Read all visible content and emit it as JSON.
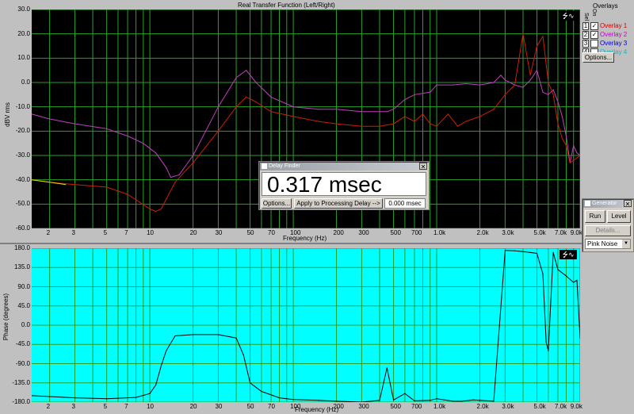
{
  "top_chart": {
    "title": "Real Transfer Function (Left/Right)",
    "ylabel": "dBV rms",
    "xlabel": "Frequency (Hz)",
    "yticks": [
      "30.0",
      "20.0",
      "10.0",
      "0.0",
      "-10.0",
      "-20.0",
      "-30.0",
      "-40.0",
      "-50.0",
      "-60.0"
    ],
    "xticks": [
      "2",
      "3",
      "5",
      "7",
      "10",
      "20",
      "30",
      "50",
      "70",
      "100",
      "200",
      "300",
      "500",
      "700",
      "1.0k",
      "2.0k",
      "3.0k",
      "5.0k",
      "7.0k",
      "9.0k"
    ]
  },
  "bottom_chart": {
    "ylabel": "Phase (degrees)",
    "xlabel": "Frequency (Hz)",
    "yticks": [
      "180.0",
      "135.0",
      "90.0",
      "45.0",
      "0.0",
      "-45.0",
      "-90.0",
      "-135.0",
      "-180.0"
    ],
    "xticks": [
      "2",
      "3",
      "5",
      "7",
      "10",
      "20",
      "30",
      "50",
      "70",
      "100",
      "200",
      "300",
      "500",
      "700",
      "1.0k",
      "2.0k",
      "3.0k",
      "5.0k",
      "7.0k",
      "9.0k"
    ]
  },
  "overlays": {
    "title": "Overlays",
    "col_sel": "Sel",
    "col_on": "On",
    "items": [
      {
        "num": "1",
        "checked": true,
        "label": "Overlay 1",
        "color": "#d40000"
      },
      {
        "num": "2",
        "checked": true,
        "label": "Overlay 2",
        "color": "#c000c0"
      },
      {
        "num": "3",
        "checked": false,
        "label": "Overlay 3",
        "color": "#0000d0"
      },
      {
        "num": "4",
        "checked": false,
        "label": "Overlay 4",
        "color": "#00c0c0"
      }
    ],
    "options_label": "Options..."
  },
  "delay_finder": {
    "title": "Delay Finder",
    "value": "0.317 msec",
    "options_label": "Options...",
    "apply_label": "Apply to Processing Delay -->",
    "field_value": "0.000 msec"
  },
  "generator": {
    "title": "Generator",
    "run_label": "Run",
    "level_label": "Level",
    "details_label": "Details...",
    "signal_value": "Pink Noise"
  },
  "colors": {
    "plot_bg_top": "#000000",
    "grid": "#2aa02a",
    "plot_bg_bottom": "#00ffff",
    "trace_magenta": "#c040c0",
    "trace_red": "#cc2000",
    "trace_yellow": "#e0e000",
    "trace_phase": "#000000"
  },
  "chart_data": [
    {
      "type": "line",
      "title": "Real Transfer Function (Left/Right)",
      "xlabel": "Frequency (Hz)",
      "ylabel": "dBV rms",
      "xscale": "log",
      "xlim": [
        1.5,
        10000
      ],
      "ylim": [
        -60,
        30
      ],
      "grid": true,
      "series": [
        {
          "name": "Overlay 2",
          "color": "#c040c0",
          "x": [
            1.5,
            2,
            3,
            5,
            7,
            9,
            11,
            13,
            14,
            16,
            20,
            30,
            40,
            47,
            55,
            70,
            100,
            150,
            200,
            300,
            400,
            450,
            500,
            600,
            700,
            900,
            1000,
            1300,
            1600,
            2000,
            2500,
            2800,
            3000,
            3500,
            4000,
            4500,
            5000,
            5500,
            6000,
            6500,
            7000,
            7500,
            8000,
            8500,
            9000,
            9500,
            10000
          ],
          "y": [
            -13,
            -15,
            -17,
            -19,
            -22,
            -25,
            -29,
            -35,
            -39,
            -38,
            -30,
            -10,
            2,
            5,
            0,
            -6,
            -10,
            -11,
            -11,
            -12,
            -12,
            -12,
            -11,
            -7,
            -5,
            -4,
            -1,
            -1,
            -0.5,
            -1,
            0,
            3,
            1,
            -1,
            -2,
            1,
            5,
            -4,
            -5,
            -3,
            -8,
            -14,
            -22,
            -33,
            -26,
            -29,
            -30
          ]
        },
        {
          "name": "Overlay 1",
          "color": "#cc2000",
          "x": [
            1.5,
            2,
            3,
            5,
            7,
            10,
            11,
            12,
            13,
            15,
            20,
            30,
            40,
            47,
            55,
            70,
            100,
            150,
            200,
            300,
            400,
            500,
            600,
            700,
            800,
            900,
            1000,
            1200,
            1400,
            1600,
            2000,
            2500,
            3000,
            3500,
            4000,
            4500,
            5000,
            5500,
            6000,
            6500,
            7000,
            7500,
            8000,
            8500,
            9000,
            10000
          ],
          "y": [
            -40,
            -41,
            -42,
            -43,
            -46,
            -52,
            -53,
            -52,
            -48,
            -41,
            -33,
            -20,
            -10,
            -6,
            -8,
            -12,
            -14,
            -16,
            -17,
            -18,
            -18,
            -17,
            -14,
            -16,
            -13,
            -17,
            -18,
            -13,
            -18,
            -16,
            -14,
            -11,
            -5,
            -1,
            20,
            3,
            15,
            19,
            0,
            -5,
            -17,
            -23,
            -26,
            -33,
            -32,
            -30
          ]
        }
      ]
    },
    {
      "type": "line",
      "xlabel": "Frequency (Hz)",
      "ylabel": "Phase (degrees)",
      "xscale": "log",
      "xlim": [
        1.5,
        10000
      ],
      "ylim": [
        -180,
        180
      ],
      "grid": true,
      "series": [
        {
          "color": "#000000",
          "x": [
            1.5,
            3,
            5,
            8,
            10,
            11,
            12,
            13,
            15,
            20,
            30,
            40,
            45,
            50,
            60,
            80,
            100,
            150,
            200,
            300,
            400,
            450,
            500,
            600,
            700,
            900,
            1000,
            1300,
            1500,
            1800,
            2000,
            2500,
            3000,
            3500,
            4000,
            4500,
            5000,
            5500,
            5800,
            6000,
            6500,
            7000,
            8000,
            9000,
            9500,
            10000
          ],
          "y": [
            -165,
            -170,
            -172,
            -169,
            -160,
            -140,
            -95,
            -60,
            -25,
            -22,
            -22,
            -30,
            -70,
            -135,
            -155,
            -170,
            -174,
            -176,
            -178,
            -180,
            -176,
            -100,
            -175,
            -160,
            -177,
            -176,
            -172,
            -178,
            -178,
            -175,
            -176,
            -178,
            175,
            174,
            172,
            170,
            168,
            120,
            -40,
            -60,
            170,
            130,
            115,
            100,
            105,
            -30
          ]
        }
      ]
    }
  ]
}
